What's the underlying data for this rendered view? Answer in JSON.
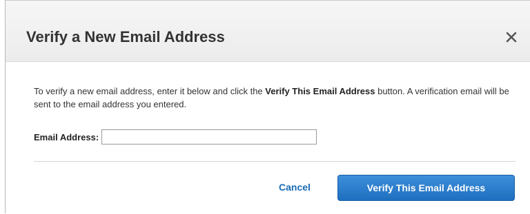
{
  "dialog": {
    "title": "Verify a New Email Address",
    "close_icon": "close-icon"
  },
  "body": {
    "instructions_before": "To verify a new email address, enter it below and click the ",
    "instructions_bold": "Verify This Email Address",
    "instructions_after": " button. A verification email will be sent to the email address you entered.",
    "email_label": "Email Address:",
    "email_value": "",
    "email_placeholder": ""
  },
  "actions": {
    "cancel_label": "Cancel",
    "verify_label": "Verify This Email Address"
  },
  "colors": {
    "primary_button": "#2a7cc9",
    "link": "#1a6bb5",
    "header_bg": "#f2f2f2"
  }
}
